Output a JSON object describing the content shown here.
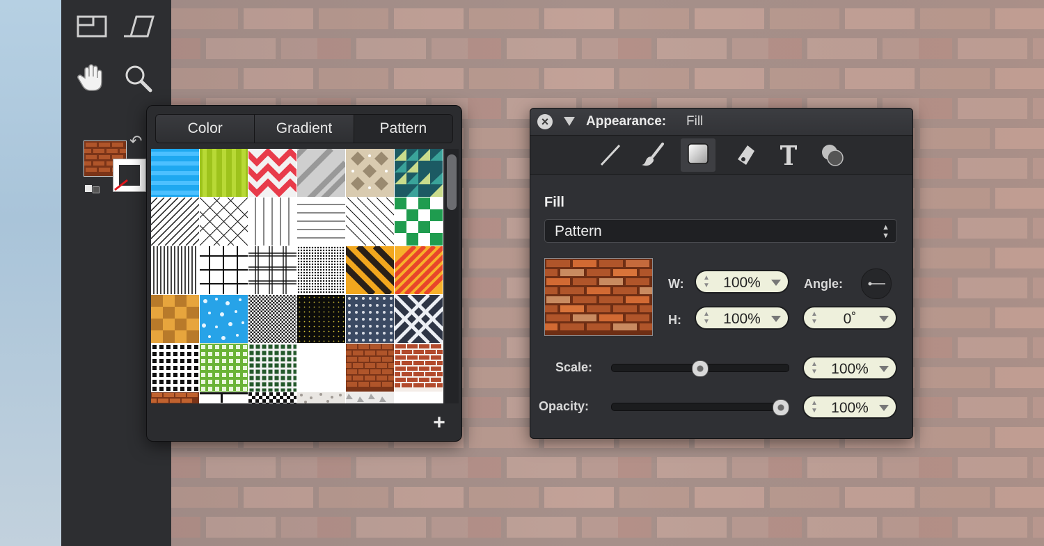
{
  "toolbar": {
    "tools": [
      {
        "name": "artboard-tool"
      },
      {
        "name": "skew-tool"
      },
      {
        "name": "hand-tool"
      },
      {
        "name": "zoom-tool"
      }
    ]
  },
  "pattern_popover": {
    "tabs": [
      "Color",
      "Gradient",
      "Pattern"
    ],
    "selected_tab": "Pattern",
    "add_label": "+"
  },
  "inspector": {
    "title_label": "Appearance:",
    "title_value": "Fill",
    "section_label": "Fill",
    "fill_type": "Pattern",
    "w_label": "W:",
    "w_value": "100%",
    "h_label": "H:",
    "h_value": "100%",
    "angle_label": "Angle:",
    "angle_value": "0˚",
    "scale_label": "Scale:",
    "scale_value": "100%",
    "scale_slider": 0.5,
    "opacity_label": "Opacity:",
    "opacity_value": "100%",
    "opacity_slider": 1.0,
    "tabs": [
      "stroke",
      "brush",
      "fill",
      "effects",
      "text",
      "blend"
    ],
    "active_tab": "fill"
  },
  "colors": {
    "panel": "#2f3034",
    "field": "#eef0dc",
    "brick": "#b0552a"
  }
}
